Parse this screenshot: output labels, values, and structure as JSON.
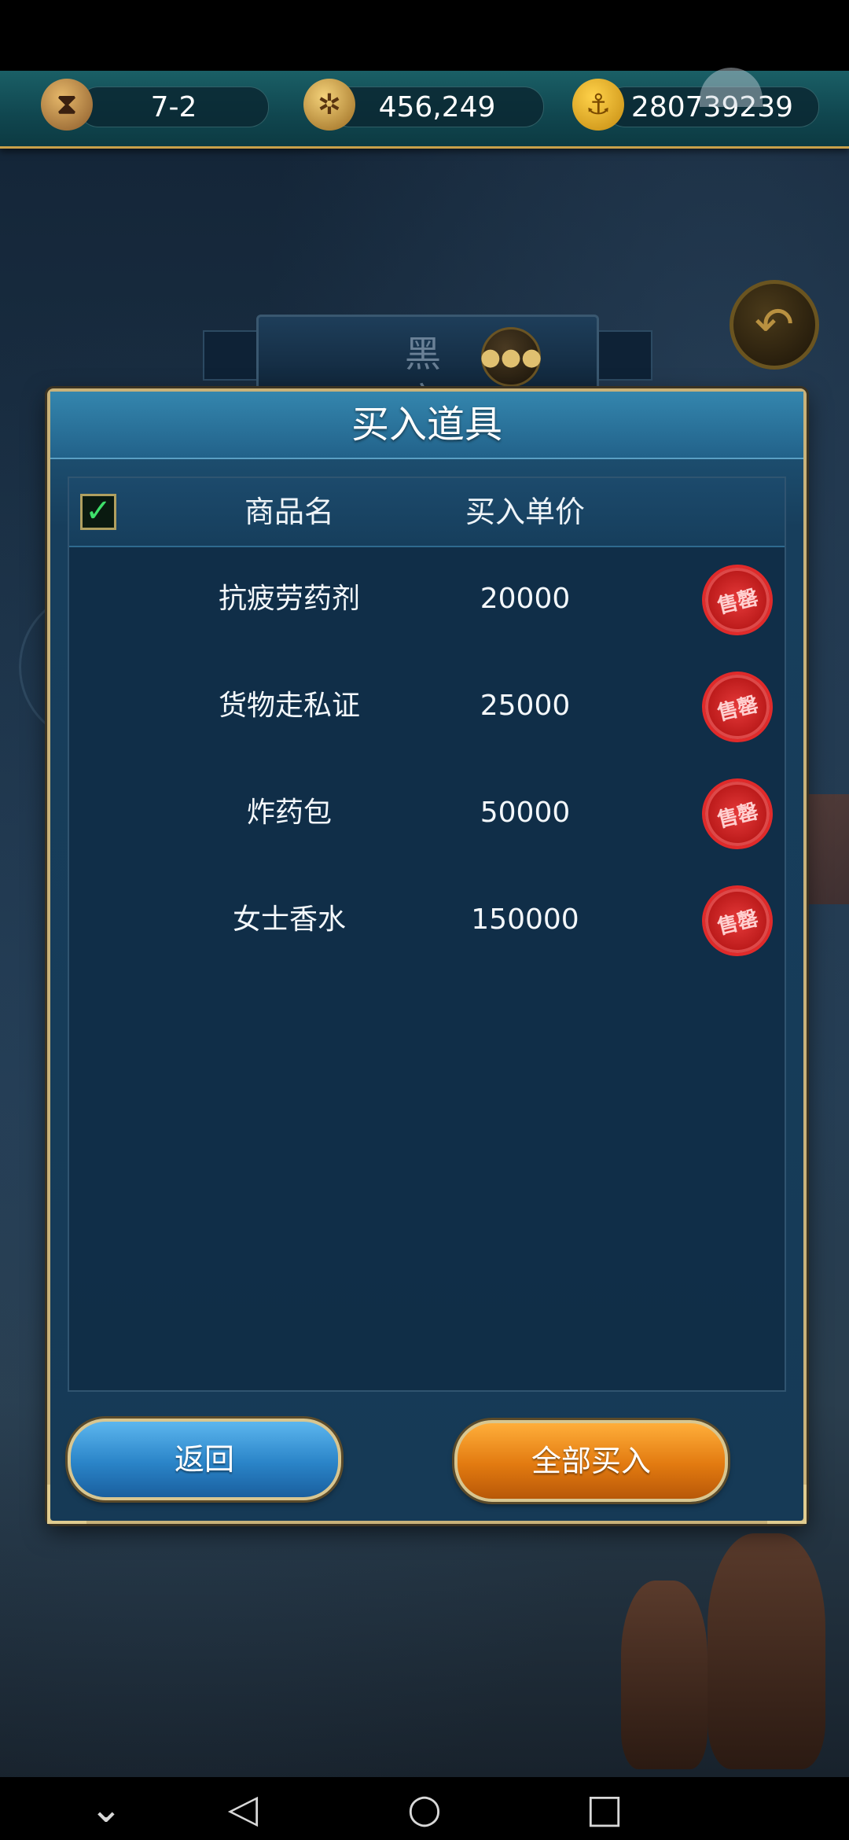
{
  "resources": {
    "stage": "7-2",
    "compass_value": "456,249",
    "gold_value": "280739239",
    "stage_icon": "hourglass-icon",
    "compass_icon": "compass-icon",
    "gold_icon": "anchor-icon"
  },
  "location": {
    "title": "黑 市",
    "chat_icon": "chat-icon",
    "back_icon": "back-arrow-icon"
  },
  "modal": {
    "title": "买入道具",
    "select_all_checked": true,
    "headers": {
      "name": "商品名",
      "price": "买入单价"
    },
    "items": [
      {
        "name": "抗疲劳药剂",
        "price": "20000",
        "status": "售罄"
      },
      {
        "name": "货物走私证",
        "price": "25000",
        "status": "售罄"
      },
      {
        "name": "炸药包",
        "price": "50000",
        "status": "售罄"
      },
      {
        "name": "女士香水",
        "price": "150000",
        "status": "售罄"
      }
    ],
    "back_button": "返回",
    "buy_all_button": "全部买入"
  },
  "colors": {
    "back_button": "#2a84c8",
    "buy_all_button": "#e27a10",
    "sold_out_stamp": "#c81e1e",
    "checkbox_check": "#3ee06a"
  },
  "nav": {
    "icons": [
      "collapse-icon",
      "back-triangle-icon",
      "home-circle-icon",
      "recents-square-icon"
    ]
  }
}
